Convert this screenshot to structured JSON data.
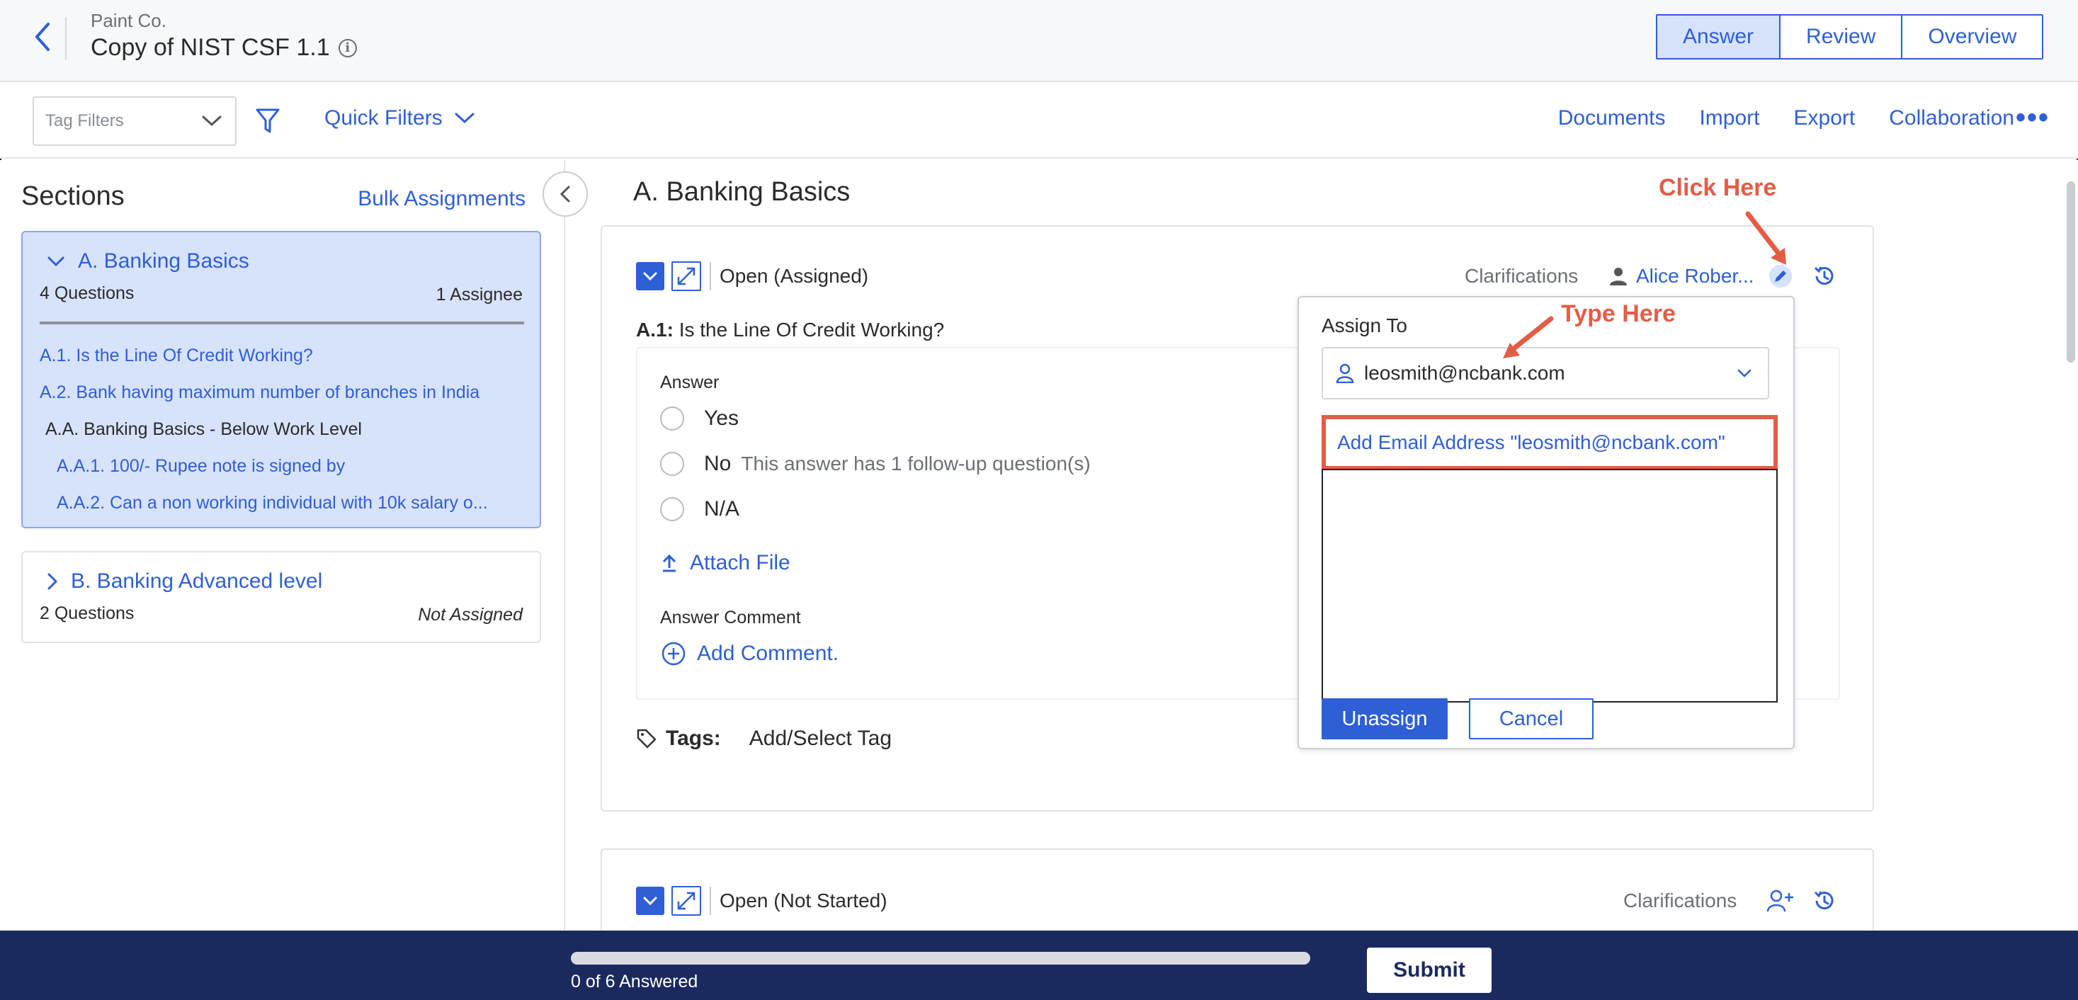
{
  "header": {
    "company": "Paint Co.",
    "title": "Copy of NIST CSF 1.1",
    "tabs": [
      {
        "label": "Answer",
        "active": true
      },
      {
        "label": "Review",
        "active": false
      },
      {
        "label": "Overview",
        "active": false
      }
    ]
  },
  "toolbar": {
    "tag_filter_placeholder": "Tag Filters",
    "quick_filters": "Quick Filters",
    "links": [
      "Documents",
      "Import",
      "Export",
      "Collaboration"
    ]
  },
  "sidebar": {
    "title": "Sections",
    "bulk_assignments": "Bulk Assignments",
    "section_a": {
      "title": "A. Banking Basics",
      "questions": "4 Questions",
      "assignee": "1 Assignee",
      "items": [
        "A.1. Is the Line Of Credit Working?",
        "A.2. Bank having maximum number of branches in India",
        "A.A. Banking Basics - Below Work Level",
        "A.A.1. 100/- Rupee note is signed by",
        "A.A.2. Can a non working individual with 10k salary o..."
      ]
    },
    "section_b": {
      "title": "B. Banking Advanced level",
      "questions": "2 Questions",
      "assignee": "Not Assigned"
    }
  },
  "main": {
    "section_title": "A. Banking Basics",
    "question1": {
      "status": "Open (Assigned)",
      "clarifications": "Clarifications",
      "assignee": "Alice Rober...",
      "number": "A.1:",
      "text": "Is the Line Of Credit Working?",
      "answer_label": "Answer",
      "options": [
        "Yes",
        "No",
        "N/A"
      ],
      "followup_note": "This answer has 1 follow-up question(s)",
      "attach_file": "Attach File",
      "answer_comment_label": "Answer Comment",
      "add_comment": "Add Comment.",
      "tags_label": "Tags:",
      "tags_value": "Add/Select Tag"
    },
    "question2": {
      "status": "Open (Not Started)",
      "clarifications": "Clarifications"
    }
  },
  "assign_popup": {
    "label": "Assign To",
    "input_value": "leosmith@ncbank.com",
    "suggestion": "Add Email Address \"leosmith@ncbank.com\"",
    "unassign": "Unassign",
    "cancel": "Cancel"
  },
  "annotations": {
    "click_here": "Click Here",
    "type_here": "Type Here"
  },
  "footer": {
    "progress_text": "0 of 6 Answered",
    "progress_answered": 0,
    "progress_total": 6,
    "submit": "Submit"
  },
  "colors": {
    "accent": "#2f5fd6",
    "annotation": "#e35d45",
    "footer_bg": "#1b2a5e",
    "selected_section_bg": "#d7e2fb"
  }
}
